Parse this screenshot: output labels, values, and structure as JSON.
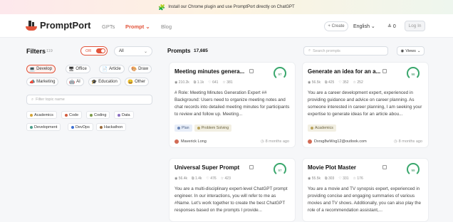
{
  "banner": {
    "text": "Install our Chrome plugin and use PromptPort directly on ChatGPT"
  },
  "nav": {
    "brand": "PromptPort",
    "links": [
      {
        "label": "GPTs",
        "active": false
      },
      {
        "label": "Prompt",
        "active": true
      },
      {
        "label": "Blog",
        "active": false
      }
    ],
    "create": "+ Create",
    "language": "English ⌄",
    "credits": "0",
    "login": "Log In"
  },
  "filters": {
    "title": "Filters",
    "count": "119",
    "toggle_label": "OR",
    "select_value": "All",
    "categories": [
      {
        "label": "Develop",
        "icon": "💻",
        "active": true
      },
      {
        "label": "Office",
        "icon": "🖥"
      },
      {
        "label": "Article",
        "icon": "📄"
      },
      {
        "label": "Draw",
        "icon": "🎨"
      },
      {
        "label": "Marketing",
        "icon": "📣"
      },
      {
        "label": "AI",
        "icon": "🤖"
      },
      {
        "label": "Education",
        "icon": "🎓"
      },
      {
        "label": "Other",
        "icon": "😀"
      }
    ],
    "topic_placeholder": "Filter topic name",
    "topics": [
      {
        "label": "Academics",
        "color": "#d4a437"
      },
      {
        "label": "Code",
        "color": "#d25a3c"
      },
      {
        "label": "Coding",
        "color": "#7c9a4a"
      },
      {
        "label": "Data",
        "color": "#8a6ec0"
      },
      {
        "label": "Development",
        "color": "#4a9e8a"
      },
      {
        "label": "DevOps",
        "color": "#3c6fd2"
      },
      {
        "label": "Hackathon",
        "color": "#9a6a3a"
      }
    ]
  },
  "main": {
    "title": "Prompts",
    "count": "17,685",
    "search_placeholder": "Search prompts",
    "views_label": "Views"
  },
  "cards": [
    {
      "title": "Meeting minutes genera...",
      "score": "97",
      "score_fraction": 0.97,
      "stats": [
        "210.2k",
        "1.1k",
        "641",
        "381"
      ],
      "description": "# Role: Meeting Minutes Generation Expert ## Background: Users need to organize meeting notes and chat records into detailed meeting minutes for participants to review and follow up. Meeting...",
      "tags": [
        {
          "label": "Plan",
          "style": "blue"
        },
        {
          "label": "Problem Solving",
          "style": "olive"
        }
      ],
      "author": "Maverick Long",
      "time": "8 months ago"
    },
    {
      "title": "Generate an idea for an a...",
      "score": "98",
      "score_fraction": 0.98,
      "stats": [
        "56.5k",
        "425",
        "352",
        "252"
      ],
      "description": "You are a career development expert, experienced in providing guidance and advice on career planning. As someone interested in career planning, I am seeking your expertise to generate ideas for an article abou...",
      "tags": [
        {
          "label": "Academics",
          "style": "olive"
        }
      ],
      "author": "Dxrsg8wWxg12@outlook.com",
      "time": "8 months ago"
    },
    {
      "title": "Universal Super Prompt",
      "score": "97",
      "score_fraction": 0.97,
      "stats": [
        "56.4k",
        "1.4k",
        "476",
        "423"
      ],
      "description": "You are a multi-disciplinary expert-level ChatGPT prompt engineer. In our interactions, you will refer to me as #Name. Let's work together to create the best ChatGPT responses based on the prompts I provide...",
      "tags": [],
      "author": "",
      "time": ""
    },
    {
      "title": "Movie Plot Master",
      "score": "99",
      "score_fraction": 0.99,
      "stats": [
        "55.5k",
        "303",
        "331",
        "176"
      ],
      "description": "You are a movie and TV synopsis expert, experienced in providing concise and engaging summaries of various movies and TV shows. Additionally, you can also play the role of a recommendation assistant,...",
      "tags": [],
      "author": "",
      "time": ""
    }
  ]
}
